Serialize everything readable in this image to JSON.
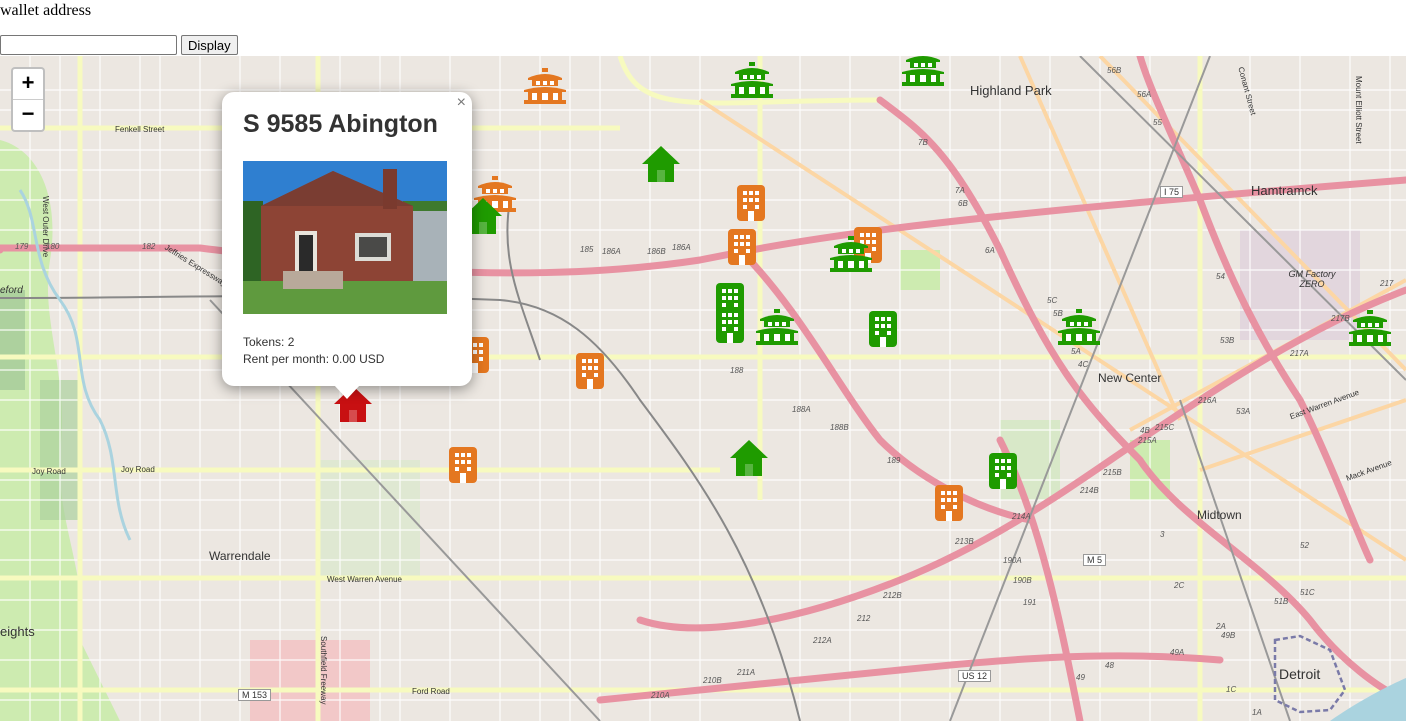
{
  "header": {
    "label": "wallet address",
    "input_value": "",
    "button_label": "Display"
  },
  "map": {
    "zoom_in": "+",
    "zoom_out": "−",
    "place_labels": {
      "highland_park": "Highland Park",
      "hamtramck": "Hamtramck",
      "new_center": "New Center",
      "midtown": "Midtown",
      "warrendale": "Warrendale",
      "detroit": "Detroit",
      "gm_factory": "GM Factory ZERO",
      "heights": "eights",
      "eford": "eford"
    },
    "road_labels": {
      "fenkell": "Fenkell Street",
      "jeffries": "Jeffries Expressway",
      "joy": "Joy Road",
      "west_warren": "West Warren Avenue",
      "ford": "Ford Road",
      "east_warren": "East Warren Avenue",
      "mack": "Mack Avenue",
      "m153": "M 153",
      "us12": "US 12",
      "m5": "M 5",
      "i75": "I 75",
      "west_outer_drive": "West Outer Drive",
      "southfield": "Southfield Freeway",
      "conant": "Conant Street",
      "mount_elliott": "Mount Elliott Street"
    },
    "exits": [
      "179",
      "180",
      "182",
      "185",
      "186A",
      "186B",
      "186A",
      "188",
      "188A",
      "188B",
      "189",
      "212B",
      "212",
      "212A",
      "213B",
      "214A",
      "214B",
      "215A",
      "215B",
      "215C",
      "216A",
      "217A",
      "217B",
      "217",
      "53A",
      "53B",
      "54",
      "55",
      "56A",
      "56B",
      "7B",
      "7A",
      "6B",
      "6A",
      "5C",
      "5B",
      "5A",
      "4C",
      "4B",
      "3",
      "2C",
      "2A",
      "190A",
      "190B",
      "191",
      "210A",
      "210B",
      "211A",
      "49A",
      "49B",
      "48",
      "49",
      "1C",
      "1A",
      "51B",
      "51C",
      "52"
    ],
    "colors": {
      "green": "#1f9b00",
      "orange": "#e47720",
      "red": "#c81012"
    }
  },
  "popup": {
    "close": "×",
    "title": "S 9585 Abington",
    "tokens": "Tokens: 2",
    "rent": "Rent per month: 0.00 USD"
  },
  "markers": [
    {
      "type": "temple-icon",
      "color": "orange"
    },
    {
      "type": "temple-icon",
      "color": "green"
    },
    {
      "type": "temple-icon",
      "color": "green"
    },
    {
      "type": "house-icon",
      "color": "green"
    },
    {
      "type": "temple-icon",
      "color": "orange"
    },
    {
      "type": "building-icon",
      "color": "orange"
    },
    {
      "type": "building-icon",
      "color": "orange"
    },
    {
      "type": "building-icon",
      "color": "orange"
    },
    {
      "type": "temple-icon",
      "color": "green"
    },
    {
      "type": "building-icon",
      "color": "green"
    },
    {
      "type": "building-icon",
      "color": "green"
    },
    {
      "type": "temple-icon",
      "color": "green"
    },
    {
      "type": "building-icon",
      "color": "green"
    },
    {
      "type": "temple-icon",
      "color": "green"
    },
    {
      "type": "temple-icon",
      "color": "green"
    },
    {
      "type": "building-icon",
      "color": "orange"
    },
    {
      "type": "building-icon",
      "color": "orange"
    },
    {
      "type": "house-icon",
      "color": "red"
    },
    {
      "type": "building-icon",
      "color": "orange"
    },
    {
      "type": "house-icon",
      "color": "green"
    },
    {
      "type": "building-icon",
      "color": "green"
    },
    {
      "type": "building-icon",
      "color": "orange"
    },
    {
      "type": "house-icon",
      "color": "green"
    }
  ]
}
